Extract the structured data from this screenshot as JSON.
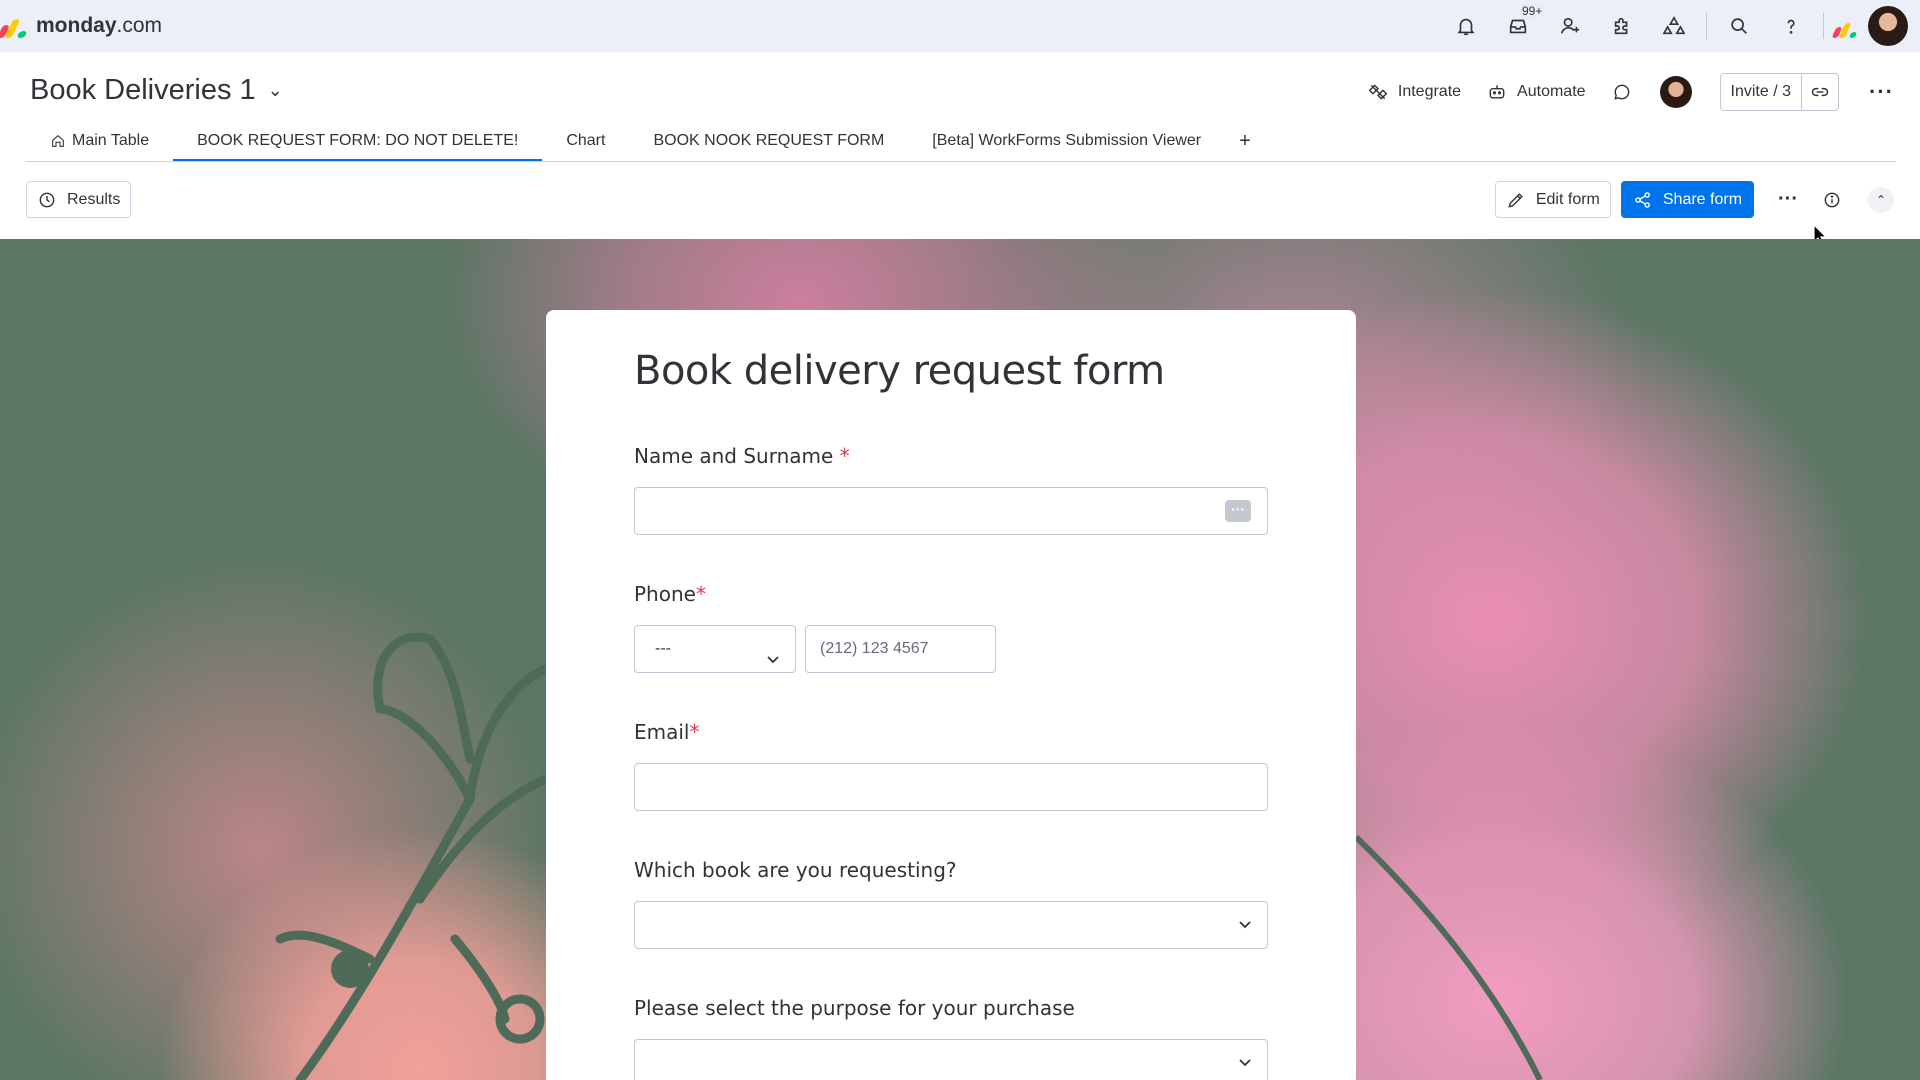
{
  "app": {
    "logo_bold": "monday",
    "logo_rest": ".com",
    "logo_colors": [
      "#ff3d57",
      "#ffcb00",
      "#00ca72"
    ]
  },
  "topbar": {
    "inbox_badge": "99+",
    "icons": [
      "bell-icon",
      "inbox-icon",
      "invite-members-icon",
      "apps-icon",
      "integrations-icon",
      "search-icon",
      "help-icon"
    ]
  },
  "board": {
    "title": "Book Deliveries 1",
    "actions": {
      "integrate": "Integrate",
      "automate": "Automate",
      "invite": "Invite / 3"
    }
  },
  "tabs": [
    {
      "label": "Main Table"
    },
    {
      "label": "BOOK REQUEST FORM: DO NOT DELETE!",
      "active": true
    },
    {
      "label": "Chart"
    },
    {
      "label": "BOOK NOOK REQUEST FORM"
    },
    {
      "label": "[Beta] WorkForms Submission Viewer"
    }
  ],
  "tab_add": "+",
  "toolbar": {
    "results": "Results",
    "edit_form": "Edit form",
    "share_form": "Share form"
  },
  "form": {
    "title": "Book delivery request form",
    "fields": {
      "name": {
        "label": "Name and Surname",
        "required_mark": "*"
      },
      "phone": {
        "label": "Phone",
        "required_mark": "*",
        "country_code": "---",
        "placeholder": "(212) 123 4567"
      },
      "email": {
        "label": "Email",
        "required_mark": "*"
      },
      "book": {
        "label": "Which book are you requesting?"
      },
      "purpose": {
        "label": "Please select the purpose for your purchase"
      }
    }
  },
  "colors": {
    "primary": "#0073ea",
    "required": "#d83a52",
    "topbar_bg": "#eceff8",
    "art_green": "#5a7664",
    "art_pink": "#ea8fb4"
  }
}
